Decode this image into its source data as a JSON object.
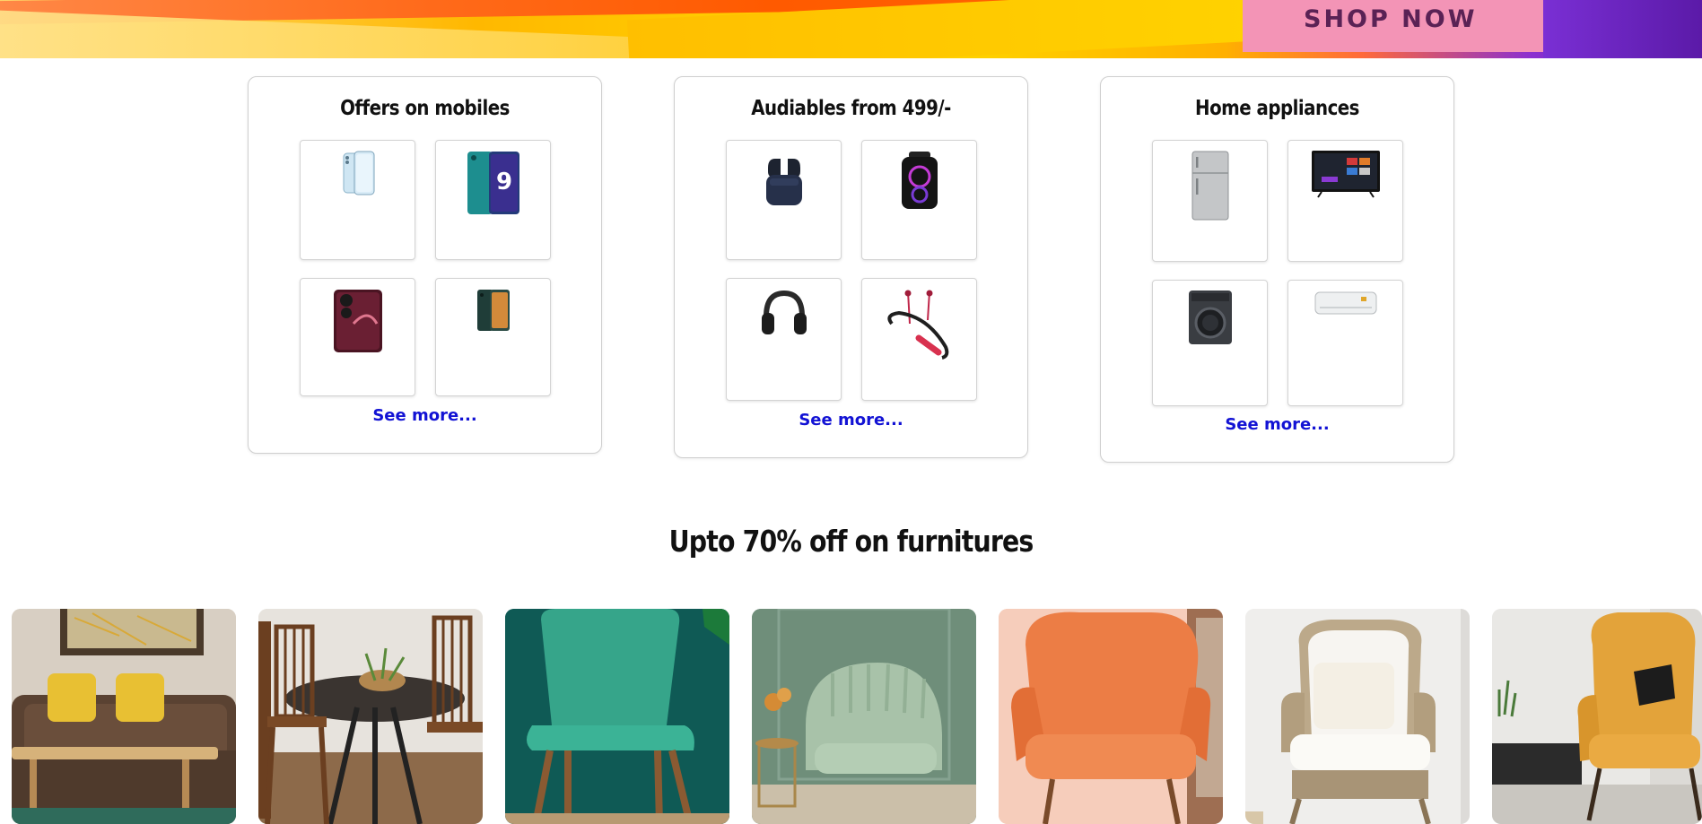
{
  "banner": {
    "cta_label": "SHOP NOW"
  },
  "sections": [
    {
      "title": "Offers on mobiles",
      "see_more": "See more...",
      "items": [
        {
          "icon": "smartphone-light-blue-icon"
        },
        {
          "icon": "smartphone-teal-icon"
        },
        {
          "icon": "smartphone-maroon-icon"
        },
        {
          "icon": "smartphone-dark-green-icon"
        }
      ]
    },
    {
      "title": "Audiables from 499/-",
      "see_more": "See more...",
      "items": [
        {
          "icon": "earbuds-icon"
        },
        {
          "icon": "speaker-icon"
        },
        {
          "icon": "headphones-icon"
        },
        {
          "icon": "neckband-icon"
        }
      ]
    },
    {
      "title": "Home appliances",
      "see_more": "See more...",
      "items": [
        {
          "icon": "refrigerator-icon"
        },
        {
          "icon": "television-icon"
        },
        {
          "icon": "washing-machine-icon"
        },
        {
          "icon": "air-conditioner-icon"
        }
      ]
    }
  ],
  "furniture": {
    "title": "Upto 70% off on furnitures",
    "items": [
      {
        "icon": "sofa-image"
      },
      {
        "icon": "dining-set-image"
      },
      {
        "icon": "teal-chair-image"
      },
      {
        "icon": "green-armchair-image"
      },
      {
        "icon": "orange-armchair-image"
      },
      {
        "icon": "white-armchair-image"
      },
      {
        "icon": "yellow-armchair-image"
      }
    ]
  },
  "colors": {
    "link": "#1212d4",
    "card_border": "#cfcfcf",
    "text": "#111111"
  }
}
